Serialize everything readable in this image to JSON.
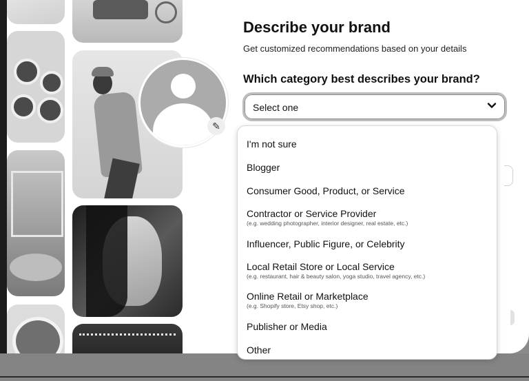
{
  "header": {
    "title": "Describe your brand",
    "subtitle": "Get customized recommendations based on your details"
  },
  "category": {
    "question": "Which category best describes your brand?",
    "selected": "Select one",
    "options": [
      {
        "label": "I'm not sure",
        "description": ""
      },
      {
        "label": "Blogger",
        "description": ""
      },
      {
        "label": "Consumer Good, Product, or Service",
        "description": ""
      },
      {
        "label": "Contractor or Service Provider",
        "description": "(e.g. wedding photographer, interior designer, real estate, etc.)"
      },
      {
        "label": "Influencer, Public Figure, or Celebrity",
        "description": ""
      },
      {
        "label": "Local Retail Store or Local Service",
        "description": "(e.g. restaurant, hair & beauty salon, yoga studio, travel agency, etc.)"
      },
      {
        "label": "Online Retail or Marketplace",
        "description": "(e.g. Shopify store, Etsy shop, etc.)"
      },
      {
        "label": "Publisher or Media",
        "description": ""
      },
      {
        "label": "Other",
        "description": ""
      }
    ]
  },
  "icons": {
    "chevron": "chevron-down-icon",
    "edit": "pencil-icon",
    "avatar": "default-avatar-icon"
  }
}
